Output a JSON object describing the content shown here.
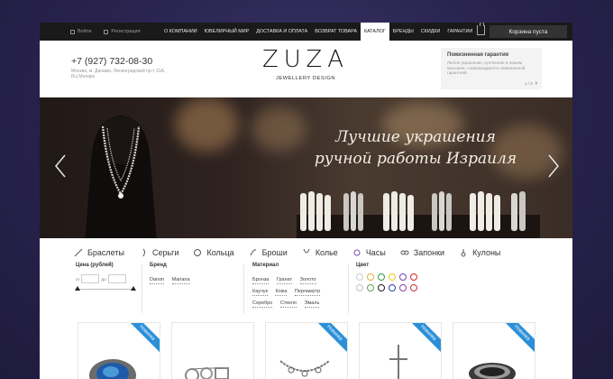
{
  "topbar": {
    "login": "Войти",
    "register": "Регистрация",
    "nav": [
      "О компании",
      "Ювелирный мир",
      "Доставка и оплата",
      "Возврат товара",
      "Каталог",
      "Бренды",
      "Скидки",
      "Гарантии"
    ],
    "active_nav": "Каталог",
    "cart": "Корзина пуста"
  },
  "header": {
    "phone": "+7 (927) 732-08-30",
    "address": "Москва, м. Динамо, Ленинградский пр-т 31А, БЦ Монарх",
    "logo_word": "ZUZA",
    "logo_sub": "JEWELLERY DESIGN",
    "guarantee": {
      "title": "Пожизненная гарантия",
      "text": "Любое украшение, купленное в нашем магазине, сопровождается пожизненной гарантией.",
      "pager": "1 / 3"
    }
  },
  "banner": {
    "line1": "Лучшие украшения",
    "line2": "ручной работы Израиля"
  },
  "categories": [
    "Браслеты",
    "Серьги",
    "Кольца",
    "Броши",
    "Колье",
    "Часы",
    "Запонки",
    "Кулоны"
  ],
  "filters": {
    "price_title": "Цена (рублей)",
    "from_label": "от",
    "to_label": "до",
    "brand_title": "Бренд",
    "brands": [
      "Danon",
      "Mariana"
    ],
    "material_title": "Материал",
    "materials": [
      "Бронза",
      "Гранат",
      "Золото",
      "Каучук",
      "Кожа",
      "Перламутр",
      "Серебро",
      "Стекло",
      "Эмаль"
    ],
    "color_title": "Цвет",
    "colors": [
      "#ffffff",
      "#d7b13b",
      "#2f9b46",
      "#e2cb1f",
      "#7b3fb3",
      "#d6262c",
      "#bfbfbf",
      "#5aa64b",
      "#1f1f1f",
      "#2c3fa7",
      "#8e44ad",
      "#cc3333"
    ]
  },
  "products": {
    "badge": "Новинка"
  }
}
